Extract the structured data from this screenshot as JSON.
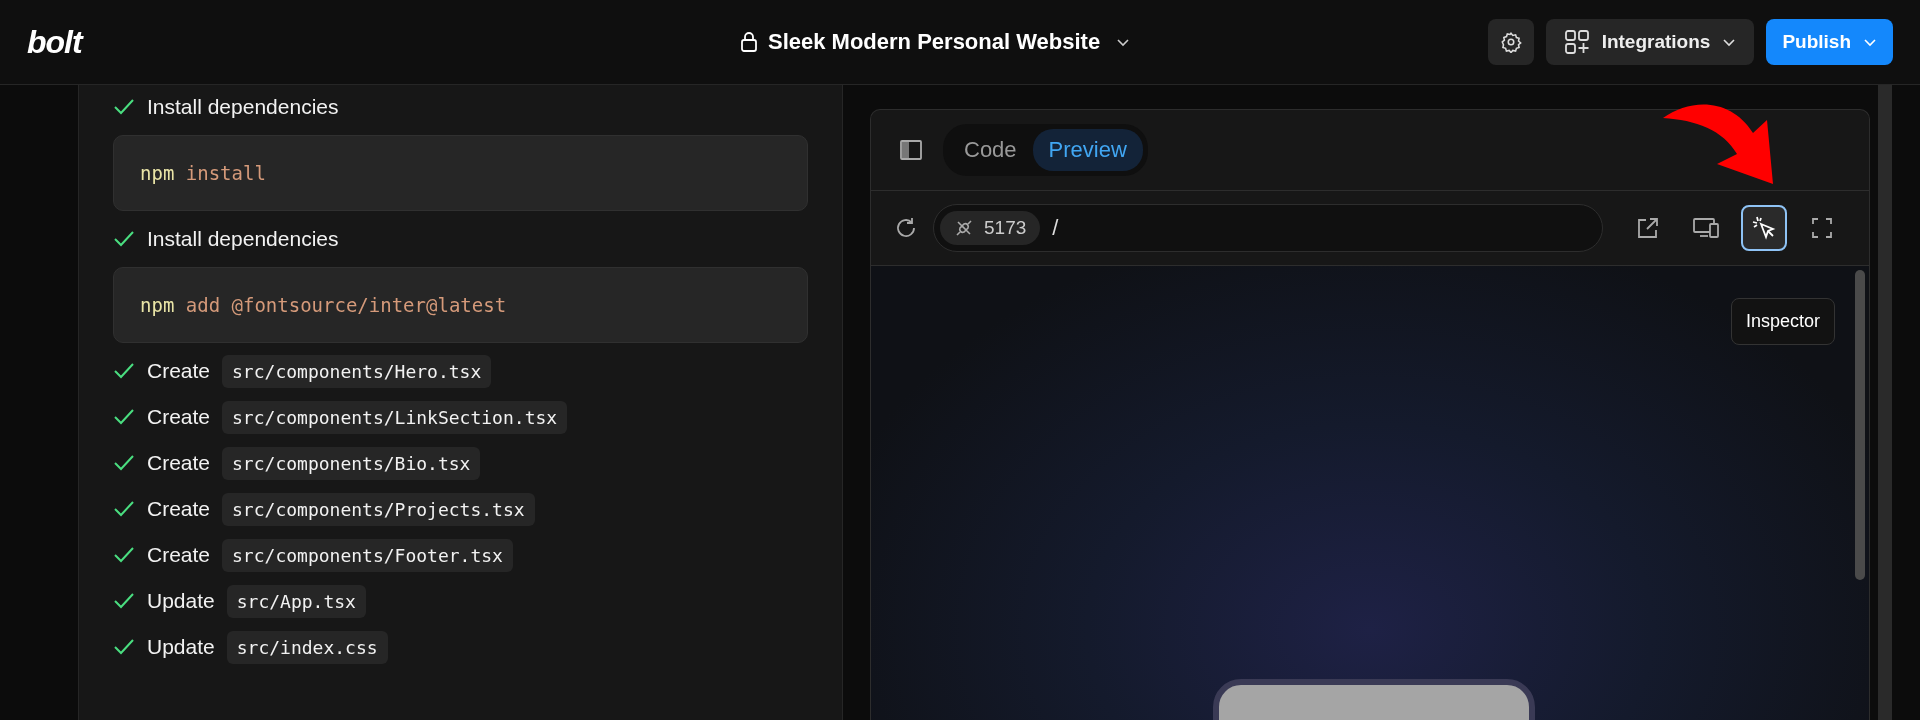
{
  "header": {
    "logo": "bolt",
    "project_title": "Sleek Modern Personal Website",
    "integrations_label": "Integrations",
    "publish_label": "Publish"
  },
  "chat": {
    "steps": [
      {
        "kind": "label",
        "action": "Install dependencies",
        "done": true
      },
      {
        "kind": "command",
        "program": "npm",
        "args": "install"
      },
      {
        "kind": "label",
        "action": "Install dependencies",
        "done": true
      },
      {
        "kind": "command",
        "program": "npm",
        "args": "add @fontsource/inter@latest"
      },
      {
        "kind": "file",
        "action": "Create",
        "path": "src/components/Hero.tsx",
        "done": true
      },
      {
        "kind": "file",
        "action": "Create",
        "path": "src/components/LinkSection.tsx",
        "done": true
      },
      {
        "kind": "file",
        "action": "Create",
        "path": "src/components/Bio.tsx",
        "done": true
      },
      {
        "kind": "file",
        "action": "Create",
        "path": "src/components/Projects.tsx",
        "done": true
      },
      {
        "kind": "file",
        "action": "Create",
        "path": "src/components/Footer.tsx",
        "done": true
      },
      {
        "kind": "file",
        "action": "Update",
        "path": "src/App.tsx",
        "done": true
      },
      {
        "kind": "file",
        "action": "Update",
        "path": "src/index.css",
        "done": true
      }
    ]
  },
  "workbench": {
    "tabs": [
      {
        "label": "Code",
        "selected": false
      },
      {
        "label": "Preview",
        "selected": true
      }
    ],
    "address": {
      "port": "5173",
      "path": "/"
    },
    "tools": [
      {
        "kind": "external",
        "selected": false
      },
      {
        "kind": "devices",
        "selected": false
      },
      {
        "kind": "inspector",
        "selected": true
      },
      {
        "kind": "fullscreen",
        "selected": false
      }
    ],
    "tooltip": "Inspector"
  }
}
